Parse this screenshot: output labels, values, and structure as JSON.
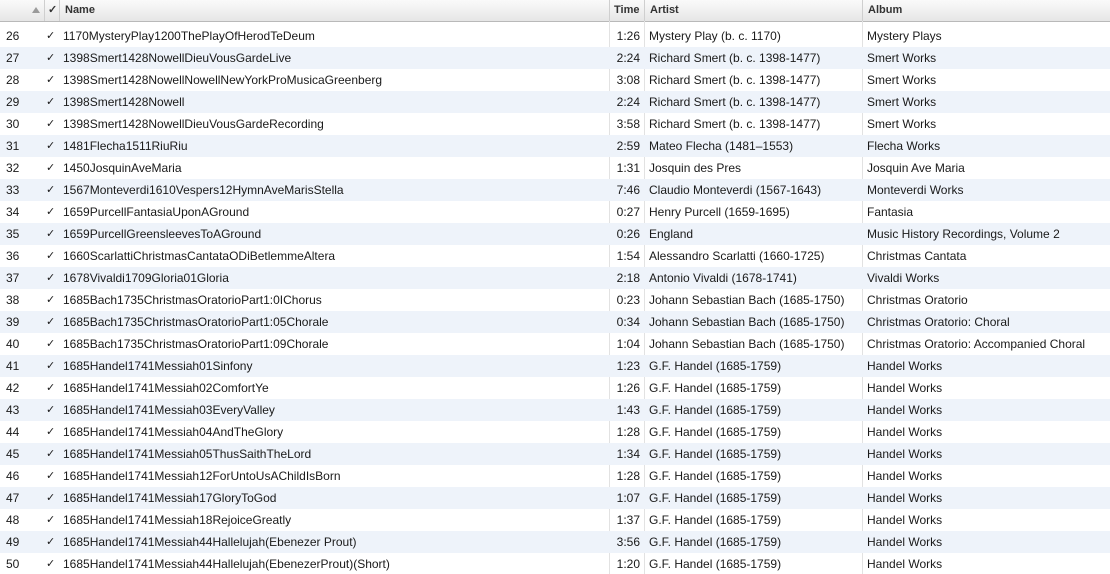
{
  "header": {
    "checkmark": "✓",
    "name": "Name",
    "time": "Time",
    "artist": "Artist",
    "album": "Album"
  },
  "rows": [
    {
      "num": "26",
      "check": "✓",
      "name": "1170MysteryPlay1200ThePlayOfHerodTeDeum",
      "time": "1:26",
      "artist": "Mystery Play (b. c. 1170)",
      "album": "Mystery Plays"
    },
    {
      "num": "27",
      "check": "✓",
      "name": "1398Smert1428NowellDieuVousGardeLive",
      "time": "2:24",
      "artist": "Richard Smert (b. c. 1398-1477)",
      "album": "Smert Works"
    },
    {
      "num": "28",
      "check": "✓",
      "name": "1398Smert1428NowellNowellNewYorkProMusicaGreenberg",
      "time": "3:08",
      "artist": "Richard Smert (b. c. 1398-1477)",
      "album": "Smert Works"
    },
    {
      "num": "29",
      "check": "✓",
      "name": "1398Smert1428Nowell",
      "time": "2:24",
      "artist": "Richard Smert (b. c. 1398-1477)",
      "album": "Smert Works"
    },
    {
      "num": "30",
      "check": "✓",
      "name": "1398Smert1428NowellDieuVousGardeRecording",
      "time": "3:58",
      "artist": "Richard Smert (b. c. 1398-1477)",
      "album": "Smert Works"
    },
    {
      "num": "31",
      "check": "✓",
      "name": "1481Flecha1511RiuRiu",
      "time": "2:59",
      "artist": "Mateo Flecha (1481–1553)",
      "album": "Flecha Works"
    },
    {
      "num": "32",
      "check": "✓",
      "name": "1450JosquinAveMaria",
      "time": "1:31",
      "artist": "Josquin des Pres",
      "album": "Josquin Ave Maria"
    },
    {
      "num": "33",
      "check": "✓",
      "name": "1567Monteverdi1610Vespers12HymnAveMarisStella",
      "time": "7:46",
      "artist": "Claudio Monteverdi (1567-1643)",
      "album": "Monteverdi Works"
    },
    {
      "num": "34",
      "check": "✓",
      "name": "1659PurcellFantasiaUponAGround",
      "time": "0:27",
      "artist": "Henry Purcell (1659-1695)",
      "album": "Fantasia"
    },
    {
      "num": "35",
      "check": "✓",
      "name": "1659PurcellGreensleevesToAGround",
      "time": "0:26",
      "artist": "England",
      "album": "Music History Recordings, Volume 2"
    },
    {
      "num": "36",
      "check": "✓",
      "name": "1660ScarlattiChristmasCantataODiBetlemmeAltera",
      "time": "1:54",
      "artist": "Alessandro Scarlatti (1660-1725)",
      "album": "Christmas Cantata"
    },
    {
      "num": "37",
      "check": "✓",
      "name": "1678Vivaldi1709Gloria01Gloria",
      "time": "2:18",
      "artist": "Antonio Vivaldi (1678-1741)",
      "album": "Vivaldi Works"
    },
    {
      "num": "38",
      "check": "✓",
      "name": "1685Bach1735ChristmasOratorioPart1:0IChorus",
      "time": "0:23",
      "artist": "Johann Sebastian Bach (1685-1750)",
      "album": "Christmas Oratorio"
    },
    {
      "num": "39",
      "check": "✓",
      "name": "1685Bach1735ChristmasOratorioPart1:05Chorale",
      "time": "0:34",
      "artist": "Johann Sebastian Bach (1685-1750)",
      "album": "Christmas Oratorio: Choral"
    },
    {
      "num": "40",
      "check": "✓",
      "name": "1685Bach1735ChristmasOratorioPart1:09Chorale",
      "time": "1:04",
      "artist": "Johann Sebastian Bach (1685-1750)",
      "album": "Christmas Oratorio: Accompanied Choral"
    },
    {
      "num": "41",
      "check": "✓",
      "name": "1685Handel1741Messiah01Sinfony",
      "time": "1:23",
      "artist": "G.F. Handel (1685-1759)",
      "album": "Handel Works"
    },
    {
      "num": "42",
      "check": "✓",
      "name": "1685Handel1741Messiah02ComfortYe",
      "time": "1:26",
      "artist": "G.F. Handel (1685-1759)",
      "album": "Handel Works"
    },
    {
      "num": "43",
      "check": "✓",
      "name": "1685Handel1741Messiah03EveryValley",
      "time": "1:43",
      "artist": "G.F. Handel (1685-1759)",
      "album": "Handel Works"
    },
    {
      "num": "44",
      "check": "✓",
      "name": "1685Handel1741Messiah04AndTheGlory",
      "time": "1:28",
      "artist": "G.F. Handel (1685-1759)",
      "album": "Handel Works"
    },
    {
      "num": "45",
      "check": "✓",
      "name": "1685Handel1741Messiah05ThusSaithTheLord",
      "time": "1:34",
      "artist": "G.F. Handel (1685-1759)",
      "album": "Handel Works"
    },
    {
      "num": "46",
      "check": "✓",
      "name": "1685Handel1741Messiah12ForUntoUsAChildIsBorn",
      "time": "1:28",
      "artist": "G.F. Handel (1685-1759)",
      "album": "Handel Works"
    },
    {
      "num": "47",
      "check": "✓",
      "name": "1685Handel1741Messiah17GloryToGod",
      "time": "1:07",
      "artist": "G.F. Handel (1685-1759)",
      "album": "Handel Works"
    },
    {
      "num": "48",
      "check": "✓",
      "name": "1685Handel1741Messiah18RejoiceGreatly",
      "time": "1:37",
      "artist": "G.F. Handel (1685-1759)",
      "album": "Handel Works"
    },
    {
      "num": "49",
      "check": "✓",
      "name": "1685Handel1741Messiah44Hallelujah(Ebenezer Prout)",
      "time": "3:56",
      "artist": "G.F. Handel (1685-1759)",
      "album": "Handel Works"
    },
    {
      "num": "50",
      "check": "✓",
      "name": "1685Handel1741Messiah44Hallelujah(EbenezerProut)(Short)",
      "time": "1:20",
      "artist": "G.F. Handel (1685-1759)",
      "album": "Handel Works"
    }
  ]
}
